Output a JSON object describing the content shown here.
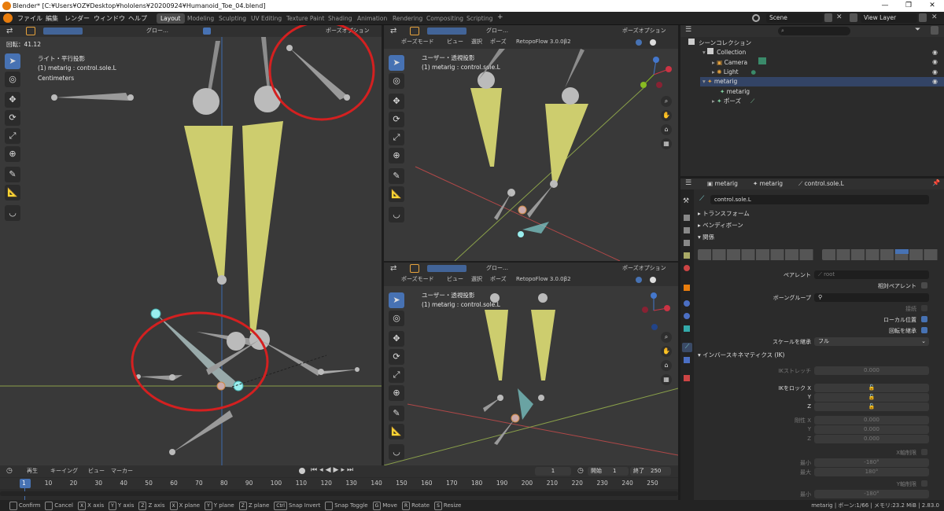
{
  "window": {
    "title": "Blender* [C:¥Users¥OZ¥Desktop¥hololens¥20200924¥Humanoid_Toe_04.blend]"
  },
  "menu": [
    "ファイル",
    "編集",
    "レンダー",
    "ウィンドウ",
    "ヘルプ"
  ],
  "workspaces": [
    "Layout",
    "Modeling",
    "Sculpting",
    "UV Editing",
    "Texture Paint",
    "Shading",
    "Animation",
    "Rendering",
    "Compositing",
    "Scripting"
  ],
  "top_right": {
    "scene": "Scene",
    "view_layer": "View Layer"
  },
  "left_viewport": {
    "header_transform": "グロー…",
    "header_pose_options": "ポーズオプション",
    "rotation_text": "回転：41.12",
    "view_name": "ライト・平行投影",
    "object_name": "(1) metarig : control.sole.L",
    "units": "Centimeters"
  },
  "top_right_viewport": {
    "mode": "ポーズモード",
    "menus": [
      "ビュー",
      "選択",
      "ポーズ"
    ],
    "addon": "RetopoFlow 3.0.0β2",
    "transform": "グロー…",
    "pose_options": "ポーズオプション",
    "view_name": "ユーザー・透視投影",
    "object_name": "(1) metarig : control.sole.L"
  },
  "bottom_right_viewport": {
    "mode": "ポーズモード",
    "menus": [
      "ビュー",
      "選択",
      "ポーズ"
    ],
    "addon": "RetopoFlow 3.0.0β2",
    "transform": "グロー…",
    "pose_options": "ポーズオプション",
    "view_name": "ユーザー・透視投影",
    "object_name": "(1) metarig : control.sole.L"
  },
  "outliner": {
    "title": "シーンコレクション",
    "search_placeholder": "",
    "items": [
      {
        "label": "Collection"
      },
      {
        "label": "Camera"
      },
      {
        "label": "Light"
      },
      {
        "label": "metarig"
      },
      {
        "label": "metarig"
      },
      {
        "label": "ポーズ"
      }
    ]
  },
  "properties": {
    "breadcrumb": [
      "metarig",
      "metarig",
      "control.sole.L"
    ],
    "bone_name": "control.sole.L",
    "sections": {
      "transform": "トランスフォーム",
      "bendy": "ベンディボーン",
      "relations": "関係",
      "ik": "インバースキネマティクス (IK)"
    },
    "parent_label": "ペアレント",
    "parent_value": "root",
    "relative_parent": "相対ペアレント",
    "bone_group_label": "ボーングループ",
    "connect_label": "接続",
    "local_location": "ローカル位置",
    "inherit_rotation": "回転を継承",
    "inherit_scale_label": "スケールを継承",
    "inherit_scale_value": "フル",
    "ik_stretch_label": "IKストレッチ",
    "ik_stretch_value": "0.000",
    "ik_lock_label": "IKをロック X",
    "ik_y": "Y",
    "ik_z": "Z",
    "stiff_label": "剛性 X",
    "stiff_x": "0.000",
    "stiff_y": "0.000",
    "stiff_z": "0.000",
    "x_limit": "X軸制限",
    "min_label": "最小",
    "max_label": "最大",
    "min_x": "-180°",
    "max_x": "180°",
    "y_limit": "Y軸制限",
    "min_y": "-180°"
  },
  "timeline": {
    "menus": [
      "再生",
      "キーイング",
      "ビュー",
      "マーカー"
    ],
    "current_frame": "1",
    "start_label": "開始",
    "start": "1",
    "end_label": "終了",
    "end": "250",
    "ticks": [
      "1",
      "10",
      "20",
      "30",
      "40",
      "50",
      "60",
      "70",
      "80",
      "90",
      "100",
      "110",
      "120",
      "130",
      "140",
      "150",
      "160",
      "170",
      "180",
      "190",
      "200",
      "210",
      "220",
      "230",
      "240",
      "250"
    ]
  },
  "statusbar": {
    "items": [
      {
        "key": "",
        "label": "Confirm"
      },
      {
        "key": "",
        "label": "Cancel"
      },
      {
        "key": "X",
        "label": "X axis"
      },
      {
        "key": "Y",
        "label": "Y axis"
      },
      {
        "key": "Z",
        "label": "Z axis"
      },
      {
        "key": "X",
        "label": "X plane"
      },
      {
        "key": "Y",
        "label": "Y plane"
      },
      {
        "key": "Z",
        "label": "Z plane"
      },
      {
        "key": "Ctrl",
        "label": "Snap Invert"
      },
      {
        "key": "",
        "label": "Snap Toggle"
      },
      {
        "key": "G",
        "label": "Move"
      },
      {
        "key": "R",
        "label": "Rotate"
      },
      {
        "key": "S",
        "label": "Resize"
      }
    ],
    "right_info": "metarig | ボーン:1/66 | メモリ:23.2 MiB | 2.83.0"
  },
  "colors": {
    "accent": "#4772b3",
    "annotation_circle": "#d42020",
    "bone_yellow": "#cdcd6e",
    "selected_bone": "#7fd0d0"
  }
}
